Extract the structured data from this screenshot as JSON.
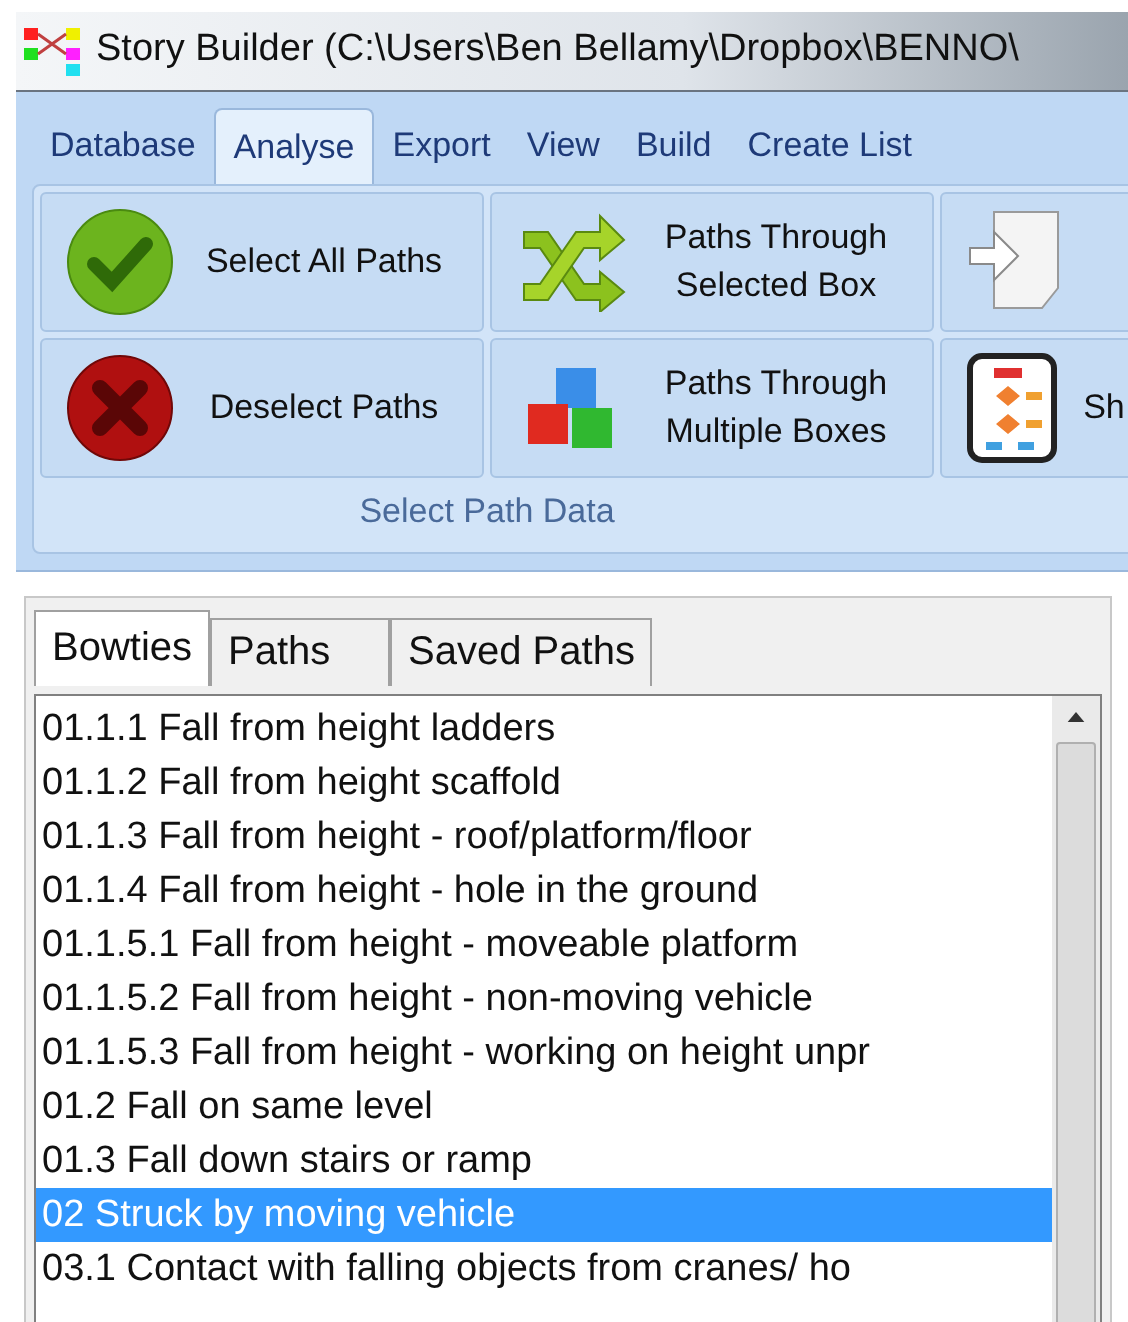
{
  "window": {
    "title": "Story Builder (C:\\Users\\Ben Bellamy\\Dropbox\\BENNO\\"
  },
  "ribbon_tabs": [
    {
      "label": "Database",
      "selected": false
    },
    {
      "label": "Analyse",
      "selected": true
    },
    {
      "label": "Export",
      "selected": false
    },
    {
      "label": "View",
      "selected": false
    },
    {
      "label": "Build",
      "selected": false
    },
    {
      "label": "Create List",
      "selected": false
    }
  ],
  "ribbon_buttons": [
    {
      "kind": "check",
      "label": "Select All Paths"
    },
    {
      "kind": "shuffle",
      "label": "Paths Through\nSelected Box"
    },
    {
      "kind": "import"
    },
    {
      "kind": "cross",
      "label": "Deselect Paths"
    },
    {
      "kind": "cubes",
      "label": "Paths Through\nMultiple Boxes"
    },
    {
      "kind": "flowchart",
      "label": "Sh"
    }
  ],
  "ribbon_group": "Select Path Data",
  "tabs": [
    {
      "label": "Bowties",
      "selected": true
    },
    {
      "label": "Paths",
      "selected": false
    },
    {
      "label": "Saved Paths",
      "selected": false
    }
  ],
  "list": [
    {
      "label": "01.1.1 Fall from height ladders",
      "selected": false
    },
    {
      "label": "01.1.2 Fall from height scaffold",
      "selected": false
    },
    {
      "label": "01.1.3 Fall from height - roof/platform/floor",
      "selected": false
    },
    {
      "label": "01.1.4 Fall from height - hole in the ground",
      "selected": false
    },
    {
      "label": "01.1.5.1 Fall from height - moveable platform",
      "selected": false
    },
    {
      "label": "01.1.5.2 Fall from height - non-moving vehicle",
      "selected": false
    },
    {
      "label": "01.1.5.3 Fall from height - working on height unpr",
      "selected": false
    },
    {
      "label": "01.2 Fall on same level",
      "selected": false
    },
    {
      "label": "01.3 Fall down stairs or ramp",
      "selected": false
    },
    {
      "label": "02 Struck by moving vehicle",
      "selected": true
    },
    {
      "label": "03.1 Contact with falling objects from cranes/ ho",
      "selected": false
    }
  ]
}
